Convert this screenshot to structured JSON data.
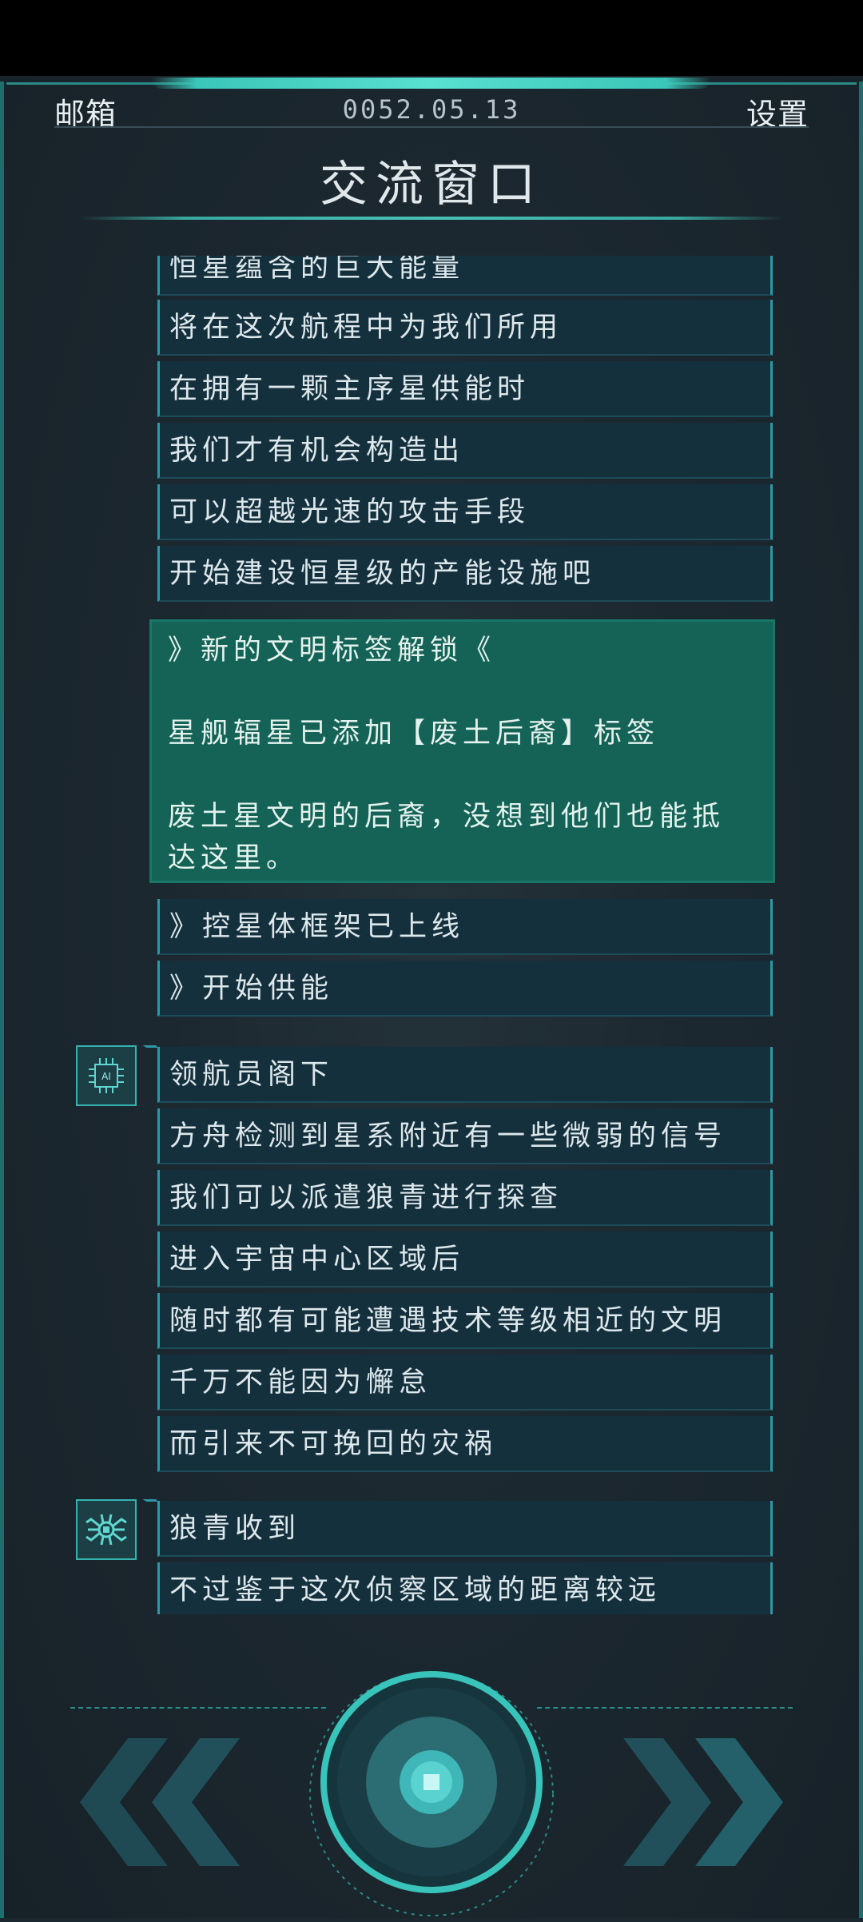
{
  "header": {
    "left_label": "邮箱",
    "date": "0052.05.13",
    "right_label": "设置",
    "title": "交流窗口"
  },
  "messages_group1": [
    "恒星蕴含的巨大能量",
    "将在这次航程中为我们所用",
    "在拥有一颗主序星供能时",
    "我们才有机会构造出",
    "可以超越光速的攻击手段",
    "开始建设恒星级的产能设施吧"
  ],
  "notice": {
    "heading": "》新的文明标签解锁《",
    "line1": "星舰辐星已添加【废土后裔】标签",
    "line2": "废土星文明的后裔，没想到他们也能抵达这里。"
  },
  "system_lines": [
    "》控星体框架已上线",
    "》开始供能"
  ],
  "ai_messages": [
    "领航员阁下",
    "方舟检测到星系附近有一些微弱的信号",
    "我们可以派遣狼青进行探查",
    "进入宇宙中心区域后",
    "随时都有可能遭遇技术等级相近的文明",
    "千万不能因为懈怠",
    "而引来不可挽回的灾祸"
  ],
  "scout_messages": [
    "狼青收到",
    "不过鉴于这次侦察区域的距离较远"
  ],
  "avatars": {
    "ai_label": "AI",
    "ai_icon": "ai-chip-icon",
    "scout_icon": "robot-spider-icon"
  },
  "controls": {
    "prev_icon": "double-chevron-left-icon",
    "next_icon": "double-chevron-right-icon",
    "core_icon": "core-button-icon"
  },
  "colors": {
    "accent": "#3ac6b8",
    "panel": "#15303d",
    "notice": "#146356"
  }
}
